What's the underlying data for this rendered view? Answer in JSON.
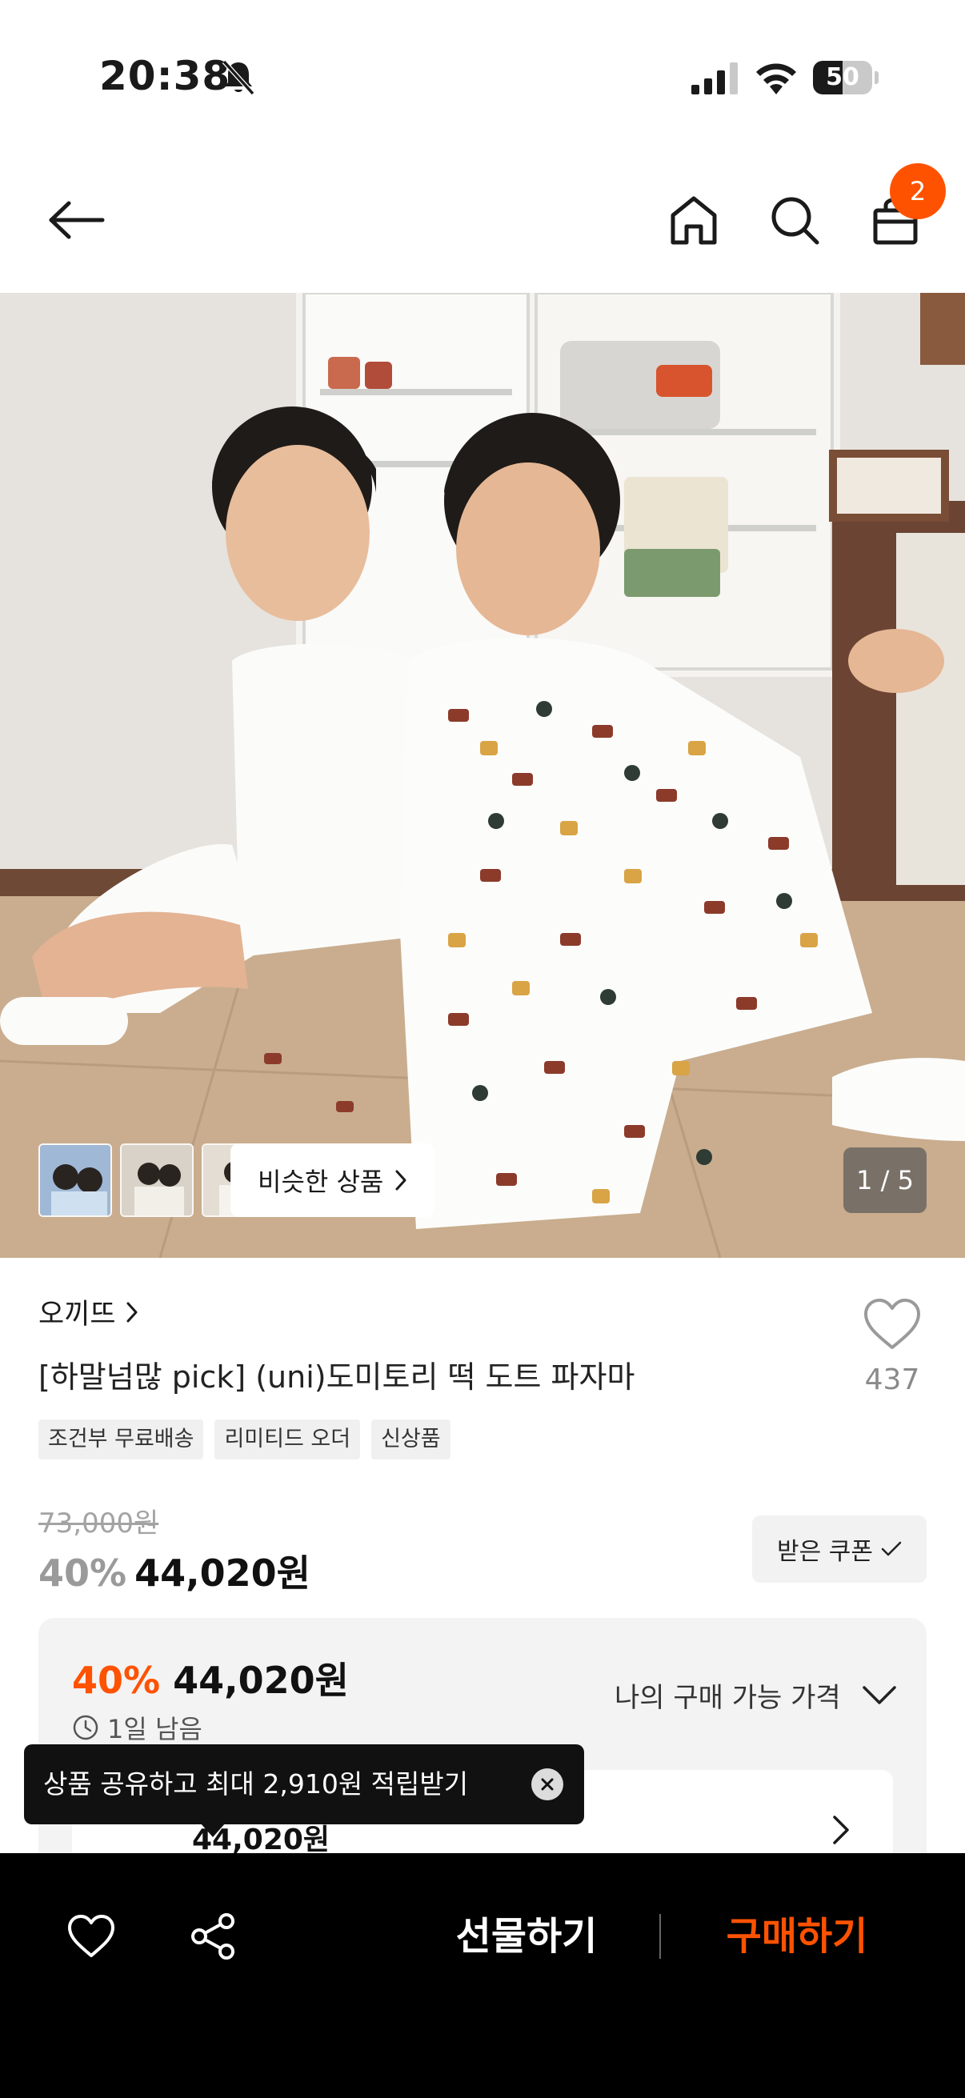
{
  "status_bar": {
    "time": "20:38",
    "battery_level": "50",
    "battery_fraction": 0.5,
    "icons": [
      "bell-off-icon",
      "signal-icon",
      "wifi-icon",
      "battery-icon"
    ]
  },
  "nav": {
    "icons": [
      "back-arrow-icon",
      "home-icon",
      "search-icon",
      "shopping-bag-icon"
    ],
    "cart_count": "2"
  },
  "gallery": {
    "similar_label": "비슷한 상품",
    "page_indicator": "1 / 5"
  },
  "product": {
    "brand": "오끼뜨",
    "title": "[하말넘많 pick] (uni)도미토리 떡 도트 파자마",
    "like_count": "437",
    "tags": [
      "조건부 무료배송",
      "리미티드 오더",
      "신상품"
    ],
    "original_price": "73,000원",
    "discount": "40%",
    "price": "44,020원",
    "coupon_label": "받은 쿠폰"
  },
  "my_price": {
    "discount": "40%",
    "price": "44,020원",
    "label": "나의 구매 가능 가격",
    "remaining": "1일 남음",
    "inner_text": "44,020원"
  },
  "toast": {
    "text": "상품 공유하고 최대 2,910원 적립받기"
  },
  "bottom_bar": {
    "gift_label": "선물하기",
    "buy_label": "구매하기"
  },
  "colors": {
    "accent": "#ff5200",
    "bottom_bar_bg": "#000000",
    "toast_bg": "#111111"
  }
}
